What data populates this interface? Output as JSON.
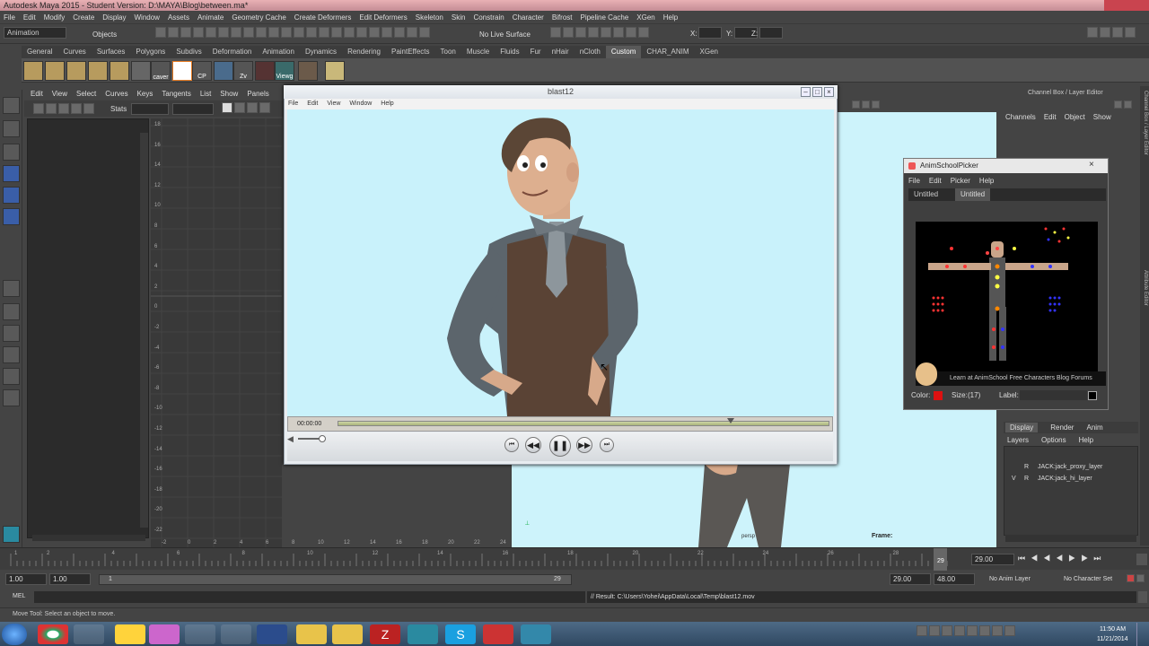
{
  "window": {
    "title": "Autodesk Maya 2015 - Student Version: D:\\MAYA\\Blog\\between.ma*"
  },
  "main_menu": [
    "File",
    "Edit",
    "Modify",
    "Create",
    "Display",
    "Window",
    "Assets",
    "Animate",
    "Geometry Cache",
    "Create Deformers",
    "Edit Deformers",
    "Skeleton",
    "Skin",
    "Constrain",
    "Character",
    "Bifrost",
    "Pipeline Cache",
    "XGen",
    "Help"
  ],
  "status_line": {
    "mode": "Animation",
    "objects_label": "Objects",
    "live_surface": "No Live Surface",
    "x_label": "X:",
    "y_label": "Y:",
    "z_label": "Z:"
  },
  "shelf_tabs": [
    "General",
    "Curves",
    "Surfaces",
    "Polygons",
    "Subdivs",
    "Deformation",
    "Animation",
    "Dynamics",
    "Rendering",
    "PaintEffects",
    "Toon",
    "Muscle",
    "Fluids",
    "Fur",
    "nHair",
    "nCloth",
    "Custom",
    "CHAR_ANIM",
    "XGen"
  ],
  "shelf_tabs_active": "Custom",
  "shelf_labels": {
    "caver": "caver",
    "cp": "CP",
    "zv": "Zv",
    "viewg": "Viewg"
  },
  "graph_panel": {
    "menu": [
      "Edit",
      "View",
      "Select",
      "Curves",
      "Keys",
      "Tangents",
      "List",
      "Show",
      "Panels"
    ],
    "stats_label": "Stats",
    "y_ticks": [
      "18",
      "16",
      "14",
      "12",
      "10",
      "8",
      "6",
      "4",
      "2",
      "0",
      "-2",
      "-4",
      "-6",
      "-8",
      "-10",
      "-12",
      "-14",
      "-16",
      "-18",
      "-20",
      "-22"
    ],
    "x_ticks": [
      "-2",
      "0",
      "2",
      "4",
      "6",
      "8",
      "10",
      "12",
      "14",
      "16",
      "18",
      "20",
      "22",
      "24"
    ]
  },
  "blast_window": {
    "title": "blast12",
    "menu": [
      "File",
      "Edit",
      "View",
      "Window",
      "Help"
    ],
    "timecode": "00:00:00",
    "progress": 0.8
  },
  "viewport": {
    "frame_label": "Frame:",
    "persp_label": "persp"
  },
  "picker": {
    "title": "AnimSchoolPicker",
    "menu": [
      "File",
      "Edit",
      "Picker",
      "Help"
    ],
    "tabs": [
      "Untitled",
      "Untitled"
    ],
    "links": "Learn at AnimSchool   Free Characters   Blog   Forums",
    "color_label": "Color:",
    "size_label": "Size:",
    "size_value": "(17)",
    "label_label": "Label:"
  },
  "channel_box": {
    "title": "Channel Box / Layer Editor",
    "menu": [
      "Channels",
      "Edit",
      "Object",
      "Show"
    ],
    "layer_tabs": [
      "Display",
      "Render",
      "Anim"
    ],
    "layer_menu": [
      "Layers",
      "Options",
      "Help"
    ],
    "layers": [
      {
        "v": "",
        "r": "R",
        "name": "JACK:jack_proxy_layer"
      },
      {
        "v": "V",
        "r": "R",
        "name": "JACK:jack_hi_layer"
      }
    ],
    "side_tabs": [
      "Channel Box / Layer Editor",
      "Attribute Editor"
    ]
  },
  "time_slider": {
    "ticks": [
      "1",
      "2",
      "4",
      "6",
      "8",
      "10",
      "12",
      "14",
      "16",
      "18",
      "20",
      "22",
      "24",
      "26",
      "28"
    ],
    "current_frame": "29",
    "current_time_field": "29.00"
  },
  "range_slider": {
    "start": "1.00",
    "start2": "1.00",
    "inner_start": "1",
    "inner_end": "29",
    "end": "29.00",
    "end2": "48.00",
    "anim_layer": "No Anim Layer",
    "char_set": "No Character Set"
  },
  "command_line": {
    "label": "MEL",
    "result": "// Result: C:\\Users\\Yohei\\AppData\\Local\\Temp\\blast12.mov"
  },
  "help_line": "Move Tool: Select an object to move.",
  "taskbar": {
    "time": "11:50 AM",
    "date": "11/21/2014"
  }
}
